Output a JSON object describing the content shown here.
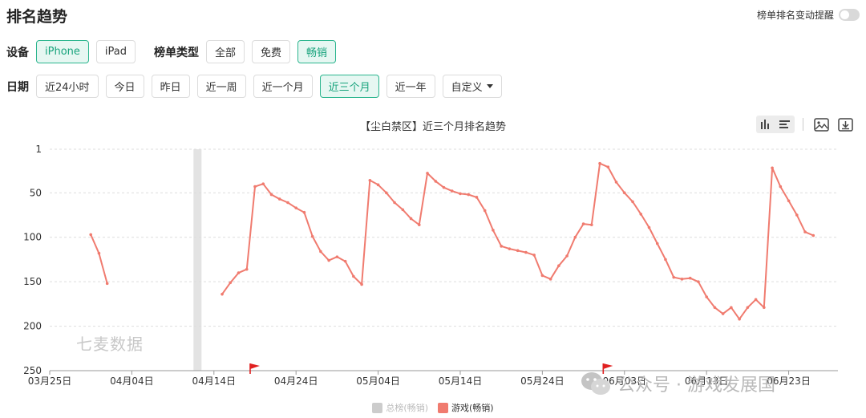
{
  "header": {
    "title": "排名趋势",
    "alert_label": "榜单排名变动提醒"
  },
  "filters": {
    "device_label": "设备",
    "devices": [
      {
        "label": "iPhone",
        "active": true
      },
      {
        "label": "iPad",
        "active": false
      }
    ],
    "chart_type_label": "榜单类型",
    "chart_types": [
      {
        "label": "全部",
        "active": false
      },
      {
        "label": "免费",
        "active": false
      },
      {
        "label": "畅销",
        "active": true
      }
    ],
    "date_label": "日期",
    "dates": [
      {
        "label": "近24小时",
        "active": false
      },
      {
        "label": "今日",
        "active": false
      },
      {
        "label": "昨日",
        "active": false
      },
      {
        "label": "近一周",
        "active": false
      },
      {
        "label": "近一个月",
        "active": false
      },
      {
        "label": "近三个月",
        "active": true
      },
      {
        "label": "近一年",
        "active": false
      }
    ],
    "custom_label": "自定义"
  },
  "colors": {
    "accent": "#17a37c",
    "series_game": "#f07b6f",
    "series_total": "#cccccc",
    "flag": "#e02020"
  },
  "watermarks": {
    "left": "七麦数据",
    "right": "公众号 · 游戏发展国"
  },
  "chart_data": {
    "type": "line",
    "title": "【尘白禁区】近三个月排名趋势",
    "y_inverted": true,
    "ylim": [
      1,
      250
    ],
    "yticks": [
      1,
      50,
      100,
      150,
      200,
      250
    ],
    "x_range": [
      "2024-03-25",
      "2024-06-29"
    ],
    "xticks": [
      {
        "date": "2024-03-25",
        "label": "03月25日"
      },
      {
        "date": "2024-04-04",
        "label": "04月04日"
      },
      {
        "date": "2024-04-14",
        "label": "04月14日"
      },
      {
        "date": "2024-04-24",
        "label": "04月24日"
      },
      {
        "date": "2024-05-04",
        "label": "05月04日"
      },
      {
        "date": "2024-05-14",
        "label": "05月14日"
      },
      {
        "date": "2024-05-24",
        "label": "05月24日"
      },
      {
        "date": "2024-06-03",
        "label": "06月03日"
      },
      {
        "date": "2024-06-13",
        "label": "06月13日"
      },
      {
        "date": "2024-06-23",
        "label": "06月23日"
      }
    ],
    "missing_data_date": "2024-04-12",
    "flags": [
      "2024-04-19",
      "2024-06-01"
    ],
    "legend": [
      {
        "name": "总榜(畅销)",
        "color": "#cccccc"
      },
      {
        "name": "游戏(畅销)",
        "color": "#f07b6f"
      }
    ],
    "series": [
      {
        "name": "游戏(畅销)",
        "segments": [
          [
            [
              "2024-03-30",
              97
            ],
            [
              "2024-03-31",
              118
            ],
            [
              "2024-04-01",
              152
            ]
          ],
          [
            [
              "2024-04-15",
              164
            ],
            [
              "2024-04-16",
              151
            ],
            [
              "2024-04-17",
              140
            ],
            [
              "2024-04-18",
              136
            ],
            [
              "2024-04-19",
              43
            ],
            [
              "2024-04-20",
              40
            ],
            [
              "2024-04-21",
              52
            ],
            [
              "2024-04-22",
              57
            ],
            [
              "2024-04-23",
              61
            ],
            [
              "2024-04-24",
              67
            ],
            [
              "2024-04-25",
              72
            ],
            [
              "2024-04-26",
              99
            ],
            [
              "2024-04-27",
              116
            ],
            [
              "2024-04-28",
              126
            ],
            [
              "2024-04-29",
              122
            ],
            [
              "2024-04-30",
              127
            ],
            [
              "2024-05-01",
              144
            ],
            [
              "2024-05-02",
              153
            ],
            [
              "2024-05-03",
              36
            ],
            [
              "2024-05-04",
              41
            ],
            [
              "2024-05-05",
              50
            ],
            [
              "2024-05-06",
              61
            ],
            [
              "2024-05-07",
              69
            ],
            [
              "2024-05-08",
              79
            ],
            [
              "2024-05-09",
              86
            ],
            [
              "2024-05-10",
              28
            ],
            [
              "2024-05-11",
              37
            ],
            [
              "2024-05-12",
              44
            ],
            [
              "2024-05-13",
              48
            ],
            [
              "2024-05-14",
              51
            ],
            [
              "2024-05-15",
              52
            ],
            [
              "2024-05-16",
              55
            ],
            [
              "2024-05-17",
              70
            ],
            [
              "2024-05-18",
              92
            ],
            [
              "2024-05-19",
              110
            ],
            [
              "2024-05-20",
              113
            ],
            [
              "2024-05-21",
              115
            ],
            [
              "2024-05-22",
              117
            ],
            [
              "2024-05-23",
              120
            ],
            [
              "2024-05-24",
              143
            ],
            [
              "2024-05-25",
              147
            ],
            [
              "2024-05-26",
              132
            ],
            [
              "2024-05-27",
              121
            ],
            [
              "2024-05-28",
              100
            ],
            [
              "2024-05-29",
              85
            ],
            [
              "2024-05-30",
              86
            ],
            [
              "2024-05-31",
              17
            ],
            [
              "2024-06-01",
              21
            ],
            [
              "2024-06-02",
              38
            ],
            [
              "2024-06-03",
              50
            ],
            [
              "2024-06-04",
              60
            ],
            [
              "2024-06-05",
              74
            ],
            [
              "2024-06-06",
              89
            ],
            [
              "2024-06-07",
              107
            ],
            [
              "2024-06-08",
              125
            ],
            [
              "2024-06-09",
              145
            ],
            [
              "2024-06-10",
              147
            ],
            [
              "2024-06-11",
              146
            ],
            [
              "2024-06-12",
              150
            ],
            [
              "2024-06-13",
              167
            ],
            [
              "2024-06-14",
              179
            ],
            [
              "2024-06-15",
              186
            ],
            [
              "2024-06-16",
              179
            ],
            [
              "2024-06-17",
              192
            ],
            [
              "2024-06-18",
              179
            ],
            [
              "2024-06-19",
              170
            ],
            [
              "2024-06-20",
              179
            ],
            [
              "2024-06-21",
              22
            ],
            [
              "2024-06-22",
              43
            ],
            [
              "2024-06-23",
              59
            ],
            [
              "2024-06-24",
              75
            ],
            [
              "2024-06-25",
              94
            ],
            [
              "2024-06-26",
              98
            ]
          ]
        ]
      }
    ]
  }
}
